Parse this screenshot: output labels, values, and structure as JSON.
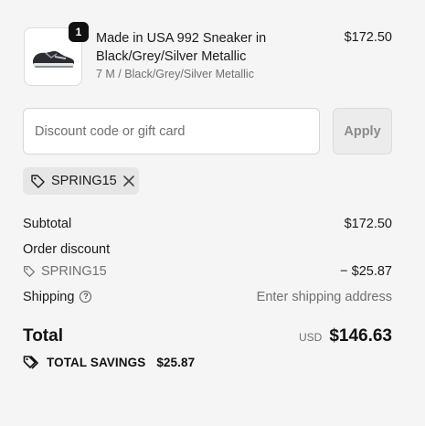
{
  "product": {
    "quantity": "1",
    "title": "Made in USA 992 Sneaker in Black/Grey/Silver Metallic",
    "variant": "7 M / Black/Grey/Silver Metallic",
    "price": "$172.50"
  },
  "discount": {
    "placeholder": "Discount code or gift card",
    "value": "",
    "apply_label": "Apply",
    "applied_code": "SPRING15"
  },
  "summary": {
    "subtotal_label": "Subtotal",
    "subtotal_value": "$172.50",
    "order_discount_label": "Order discount",
    "discount_code": "SPRING15",
    "discount_value": "− $25.87",
    "shipping_label": "Shipping",
    "shipping_value": "Enter shipping address",
    "total_label": "Total",
    "currency": "USD",
    "total_value": "$146.63",
    "savings_label": "TOTAL SAVINGS",
    "savings_value": "$25.87"
  },
  "icons": {
    "tag": "tag-icon",
    "tags": "tags-icon",
    "close": "close-icon",
    "info": "question-circle-icon"
  }
}
